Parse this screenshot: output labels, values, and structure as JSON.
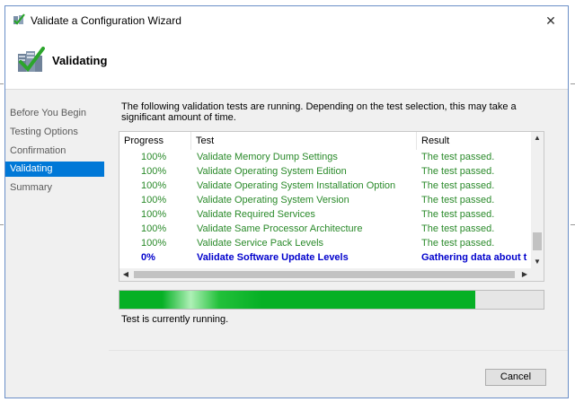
{
  "window": {
    "title": "Validate a Configuration Wizard",
    "close_glyph": "✕",
    "icon": "cluster-validate-icon"
  },
  "header": {
    "title": "Validating",
    "icon": "validating-checkmark-icon"
  },
  "sidebar": {
    "items": [
      {
        "label": "Before You Begin",
        "active": false
      },
      {
        "label": "Testing Options",
        "active": false
      },
      {
        "label": "Confirmation",
        "active": false
      },
      {
        "label": "Validating",
        "active": true
      },
      {
        "label": "Summary",
        "active": false
      }
    ]
  },
  "main": {
    "description": "The following validation tests are running. Depending on the test selection, this may take a significant amount of time.",
    "columns": {
      "progress": "Progress",
      "test": "Test",
      "result": "Result"
    },
    "rows": [
      {
        "progress": "100%",
        "test": "Validate Memory Dump Settings",
        "result": "The test passed."
      },
      {
        "progress": "100%",
        "test": "Validate Operating System Edition",
        "result": "The test passed."
      },
      {
        "progress": "100%",
        "test": "Validate Operating System Installation Option",
        "result": "The test passed."
      },
      {
        "progress": "100%",
        "test": "Validate Operating System Version",
        "result": "The test passed."
      },
      {
        "progress": "100%",
        "test": "Validate Required Services",
        "result": "The test passed."
      },
      {
        "progress": "100%",
        "test": "Validate Same Processor Architecture",
        "result": "The test passed."
      },
      {
        "progress": "100%",
        "test": "Validate Service Pack Levels",
        "result": "The test passed."
      },
      {
        "progress": "0%",
        "test": "Validate Software Update Levels",
        "result": "Gathering data about t"
      }
    ],
    "overall_progress": 0.84,
    "status": "Test is currently running."
  },
  "footer": {
    "cancel_label": "Cancel"
  },
  "colors": {
    "selection": "#0078d7",
    "passed_text": "#2a8a2a",
    "running_text": "#0000cc",
    "progress_fill": "#06b025"
  }
}
